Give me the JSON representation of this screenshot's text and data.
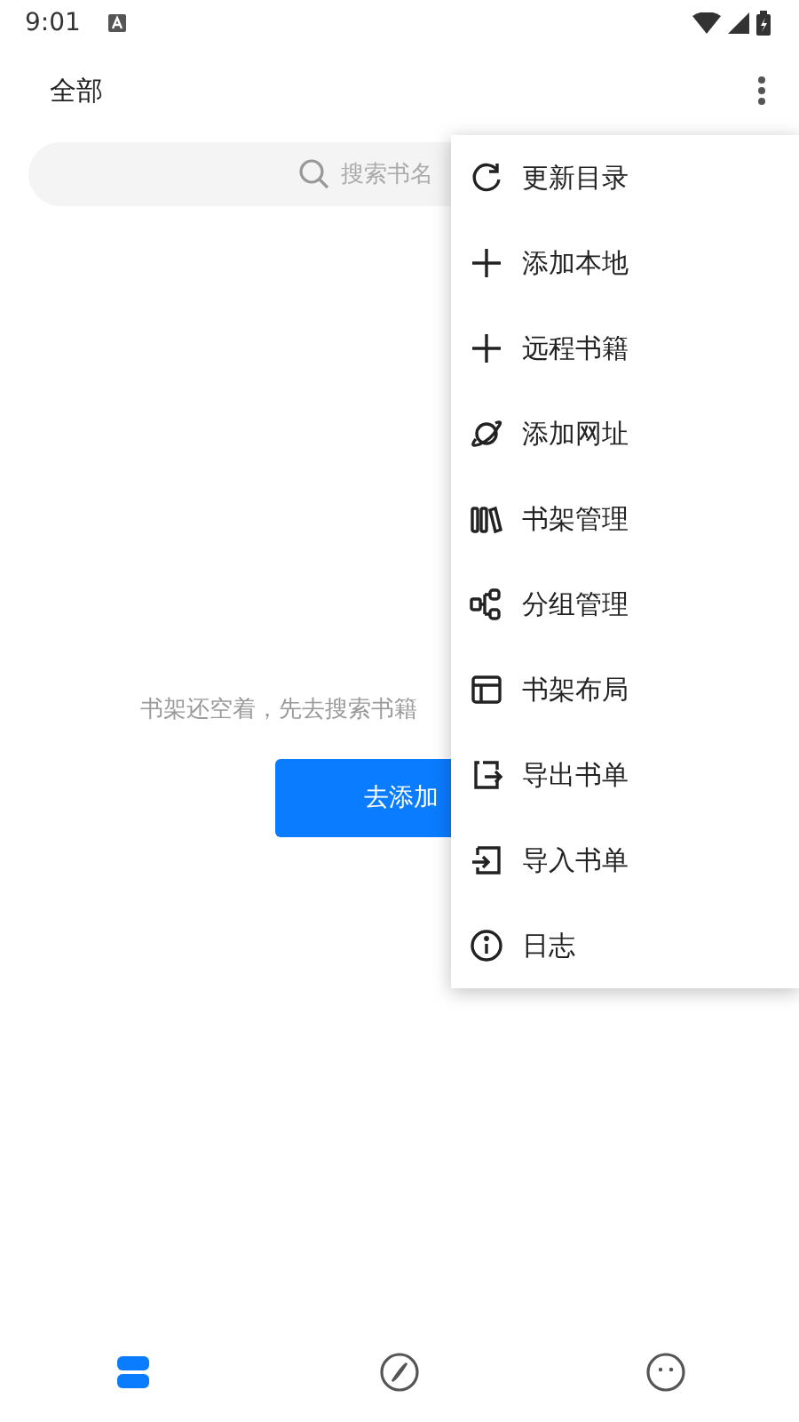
{
  "status_bar": {
    "time": "9:01"
  },
  "header": {
    "title": "全部"
  },
  "search": {
    "placeholder": "搜索书名"
  },
  "empty": {
    "message": "书架还空着，先去搜索书籍",
    "button": "去添加"
  },
  "menu": {
    "items": [
      {
        "label": "更新目录",
        "kind": "refresh"
      },
      {
        "label": "添加本地",
        "kind": "plus"
      },
      {
        "label": "远程书籍",
        "kind": "plus"
      },
      {
        "label": "添加网址",
        "kind": "planet"
      },
      {
        "label": "书架管理",
        "kind": "shelf"
      },
      {
        "label": "分组管理",
        "kind": "group"
      },
      {
        "label": "书架布局",
        "kind": "layout"
      },
      {
        "label": "导出书单",
        "kind": "export"
      },
      {
        "label": "导入书单",
        "kind": "import"
      },
      {
        "label": "日志",
        "kind": "info"
      }
    ]
  },
  "bottom_nav": [
    {
      "kind": "bookshelf",
      "selected": true
    },
    {
      "kind": "explore",
      "selected": false
    },
    {
      "kind": "profile",
      "selected": false
    }
  ]
}
